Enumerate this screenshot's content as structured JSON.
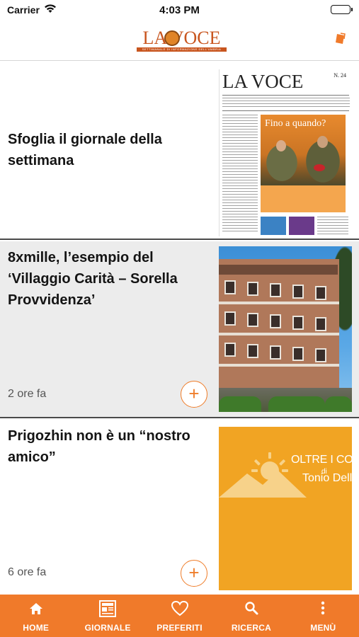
{
  "status_bar": {
    "carrier": "Carrier",
    "time": "4:03 PM"
  },
  "header": {
    "logo_text": "LA VOCE",
    "logo_subtitle": "SETTIMANALE DI INFORMAZIONE DELL'UMBRIA",
    "action_icon": "bookmark-tag-icon"
  },
  "cards": [
    {
      "title": "Sfoglia il giornale della settimana",
      "thumbnail": {
        "masthead": "LA VOCE",
        "issue": "N. 24",
        "hero_title": "Fino a quando?"
      }
    },
    {
      "title": "8xmille, l’esempio del ‘Villaggio Carità – Sorella Provvidenza’",
      "time": "2 ore fa",
      "action_label": "+"
    },
    {
      "title": "Prigozhin non è un “nostro amico”",
      "time": "6 ore fa",
      "action_label": "+",
      "thumbnail": {
        "line1": "OLTRE I CONF",
        "line2": "di",
        "line3": "Tonio Dell'O"
      }
    }
  ],
  "tab_bar": {
    "items": [
      {
        "label": "HOME",
        "icon": "home-icon"
      },
      {
        "label": "GIORNALE",
        "icon": "newspaper-icon"
      },
      {
        "label": "PREFERITI",
        "icon": "heart-icon"
      },
      {
        "label": "RICERCA",
        "icon": "search-icon"
      },
      {
        "label": "MENÙ",
        "icon": "more-vertical-icon"
      }
    ]
  },
  "colors": {
    "accent": "#f07a2a",
    "logo": "#c8551e",
    "card_selected_bg": "#ececec",
    "banner": "#f1a423"
  }
}
